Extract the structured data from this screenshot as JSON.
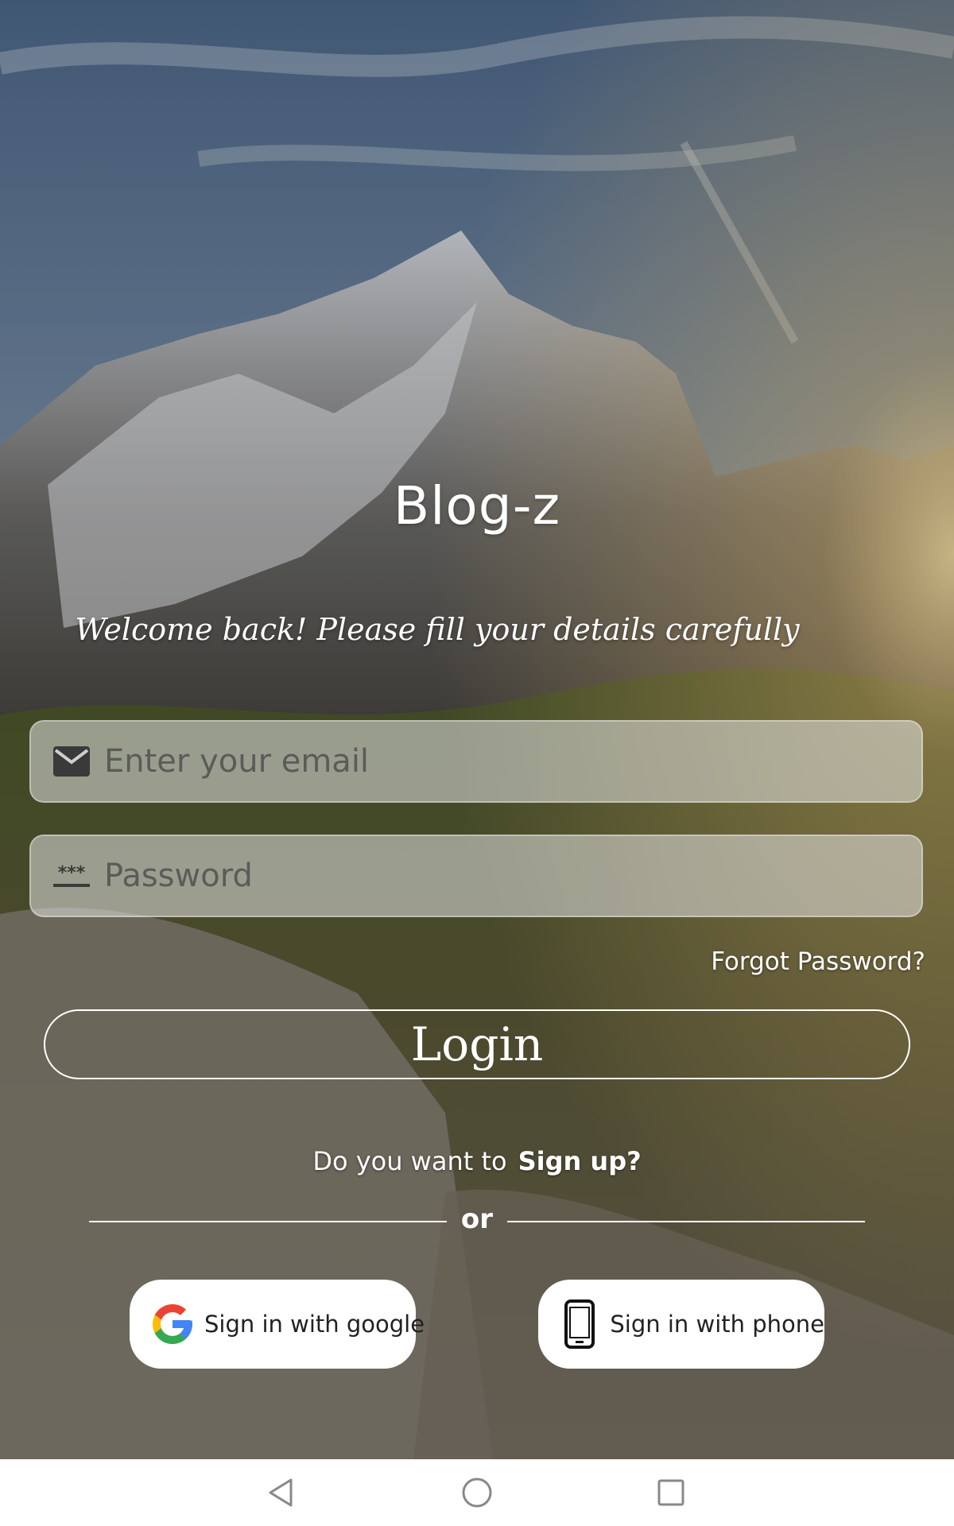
{
  "app": {
    "title": "Blog-z",
    "subtitle": "Welcome back! Please fill your details carefully"
  },
  "form": {
    "email": {
      "placeholder": "Enter your email",
      "value": "",
      "icon": "mail-icon"
    },
    "password": {
      "placeholder": "Password",
      "value": "",
      "icon": "password-dots-icon",
      "icon_glyph": "***"
    },
    "forgot_label": "Forgot Password?",
    "login_label": "Login"
  },
  "signup": {
    "prompt": "Do you want to",
    "link": "Sign up?"
  },
  "divider": {
    "label": "or"
  },
  "social": {
    "google_label": "Sign in with google",
    "google_icon": "google-g-icon",
    "phone_label": "Sign in with phone",
    "phone_icon": "smartphone-icon"
  },
  "navbar": {
    "back_icon": "back-triangle-icon",
    "home_icon": "home-circle-icon",
    "recents_icon": "recents-square-icon"
  },
  "colors": {
    "text": "#ffffff",
    "field_bg": "rgba(225,225,225,0.55)",
    "button_bg": "#ffffff",
    "google_blue": "#4285F4",
    "google_red": "#EA4335",
    "google_yellow": "#FBBC05",
    "google_green": "#34A853"
  }
}
